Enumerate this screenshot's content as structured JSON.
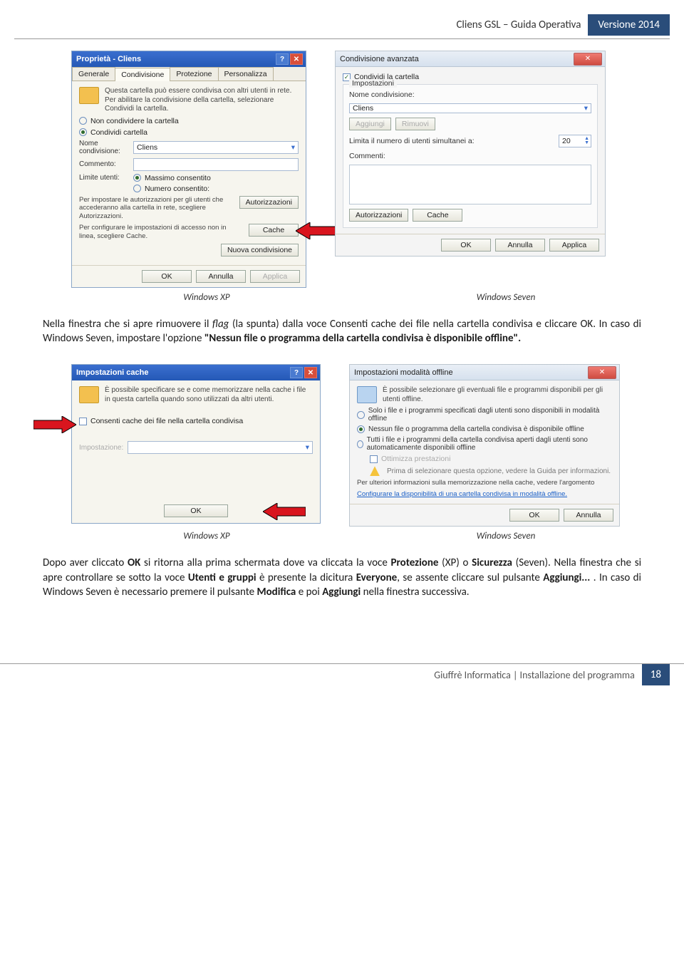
{
  "header": {
    "title_left": "Cliens GSL – Guida Operativa",
    "title_right": "Versione 2014"
  },
  "dlg1": {
    "title": "Proprietà - Cliens",
    "tabs": [
      "Generale",
      "Condivisione",
      "Protezione",
      "Personalizza"
    ],
    "hint": "Questa cartella può essere condivisa con altri utenti in rete. Per abilitare la condivisione della cartella, selezionare Condividi la cartella.",
    "radio_no_share": "Non condividere la cartella",
    "radio_share": "Condividi cartella",
    "lbl_name": "Nome condivisione:",
    "share_name": "Cliens",
    "lbl_comment": "Commento:",
    "lbl_limit": "Limite utenti:",
    "radio_max": "Massimo consentito",
    "radio_num": "Numero consentito:",
    "note_perm": "Per impostare le autorizzazioni per gli utenti che accederanno alla cartella in rete, scegliere Autorizzazioni.",
    "btn_perm": "Autorizzazioni",
    "note_cache": "Per configurare le impostazioni di accesso non in linea, scegliere Cache.",
    "btn_cache": "Cache",
    "btn_newshare": "Nuova condivisione",
    "btn_ok": "OK",
    "btn_cancel": "Annulla",
    "btn_apply": "Applica"
  },
  "dlg2": {
    "title": "Condivisione avanzata",
    "chk_share": "Condividi la cartella",
    "grp": "Impostazioni",
    "lbl_name": "Nome condivisione:",
    "share_name": "Cliens",
    "btn_add": "Aggiungi",
    "btn_remove": "Rimuovi",
    "lbl_limit": "Limita il numero di utenti simultanei a:",
    "limit_val": "20",
    "lbl_comments": "Commenti:",
    "btn_perm": "Autorizzazioni",
    "btn_cache": "Cache",
    "btn_ok": "OK",
    "btn_cancel": "Annulla",
    "btn_apply": "Applica"
  },
  "caption1_xp": "Windows XP",
  "caption1_7": "Windows Seven",
  "para1_a": "Nella finestra che si apre rimuovere il ",
  "para1_flag": "flag",
  "para1_b": " (la spunta) dalla voce Consenti cache dei file nella cartella condivisa e cliccare OK. In caso di Windows Seven, impostare l'opzione ",
  "para1_opt": "\"Nessun file o programma della cartella condivisa è disponibile offline\".",
  "dlg3": {
    "title": "Impostazioni cache",
    "hint": "È possibile specificare se e come memorizzare nella cache i file in questa cartella quando sono utilizzati da altri utenti.",
    "chk_cache": "Consenti cache dei file nella cartella condivisa",
    "lbl_set": "Impostazione:",
    "btn_ok": "OK"
  },
  "dlg4": {
    "title": "Impostazioni modalità offline",
    "hint": "È possibile selezionare gli eventuali file e programmi disponibili per gli utenti offline.",
    "opt1": "Solo i file e i programmi specificati dagli utenti sono disponibili in modalità offline",
    "opt2": "Nessun file o programma della cartella condivisa è disponibile offline",
    "opt3": "Tutti i file e i programmi della cartella condivisa aperti dagli utenti sono automaticamente disponibili offline",
    "chk_opt": "Ottimizza prestazioni",
    "warn": "Prima di selezionare questa opzione, vedere la Guida per informazioni.",
    "more": "Per ulteriori informazioni sulla memorizzazione nella cache, vedere l'argomento",
    "link": "Configurare la disponibilità di una cartella condivisa in modalità offline.",
    "btn_ok": "OK",
    "btn_cancel": "Annulla"
  },
  "caption2_xp": "Windows XP",
  "caption2_7": "Windows Seven",
  "para2": "Dopo aver cliccato OK si ritorna alla prima schermata dove va cliccata la voce Protezione (XP) o Sicurezza (Seven). Nella finestra che si apre controllare se sotto la voce Utenti e gruppi è presente la dicitura Everyone, se assente cliccare sul pulsante Aggiungi... . In caso di Windows Seven è necessario premere il pulsante Modifica e poi Aggiungi nella finestra successiva.",
  "para2_bold": {
    "b1": "OK",
    "b2": "Protezione",
    "b3": "Sicurezza",
    "b4": "Utenti e gruppi",
    "b5": "Everyone",
    "b6": "Aggiungi...",
    "b7": "Modifica",
    "b8": "Aggiungi"
  },
  "footer": {
    "text": "Giuffrè Informatica | Installazione del programma",
    "page": "18"
  }
}
